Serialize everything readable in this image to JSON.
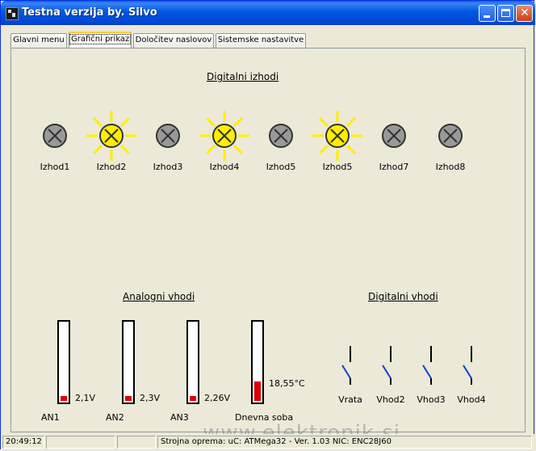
{
  "window": {
    "title": "Testna verzija by. Silvo"
  },
  "tabs": [
    {
      "label": "Glavni menu"
    },
    {
      "label": "Grafični prikaz"
    },
    {
      "label": "Določitev naslovov"
    },
    {
      "label": "Sistemske nastavitve"
    }
  ],
  "digital_outputs": {
    "heading": "Digitalni izhodi",
    "items": [
      {
        "label": "Izhod1",
        "on": false
      },
      {
        "label": "Izhod2",
        "on": true
      },
      {
        "label": "Izhod3",
        "on": false
      },
      {
        "label": "Izhod4",
        "on": true
      },
      {
        "label": "Izhod5",
        "on": false
      },
      {
        "label": "Izhod5",
        "on": true
      },
      {
        "label": "Izhod7",
        "on": false
      },
      {
        "label": "Izhod8",
        "on": false
      }
    ]
  },
  "analog_inputs": {
    "heading": "Analogni vhodi",
    "items": [
      {
        "label": "AN1",
        "value": "2,1V",
        "level": 0.06
      },
      {
        "label": "AN2",
        "value": "2,3V",
        "level": 0.06
      },
      {
        "label": "AN3",
        "value": "2,26V",
        "level": 0.06
      },
      {
        "label": "Dnevna soba",
        "value": "18,55°C",
        "level": 0.24
      }
    ]
  },
  "digital_inputs": {
    "heading": "Digitalni vhodi",
    "items": [
      {
        "label": "Vrata"
      },
      {
        "label": "Vhod2"
      },
      {
        "label": "Vhod3"
      },
      {
        "label": "Vhod4"
      }
    ]
  },
  "status": {
    "time": "20:49:12",
    "hardware": "Strojna oprema: uC: ATMega32 - Ver. 1.03 NIC: ENC28J60"
  },
  "watermark": "www.elektronik.si",
  "colors": {
    "lamp_on": "#ffee00",
    "lamp_off": "#999999",
    "switch": "#0044cc",
    "bar_fill": "#e00000"
  }
}
